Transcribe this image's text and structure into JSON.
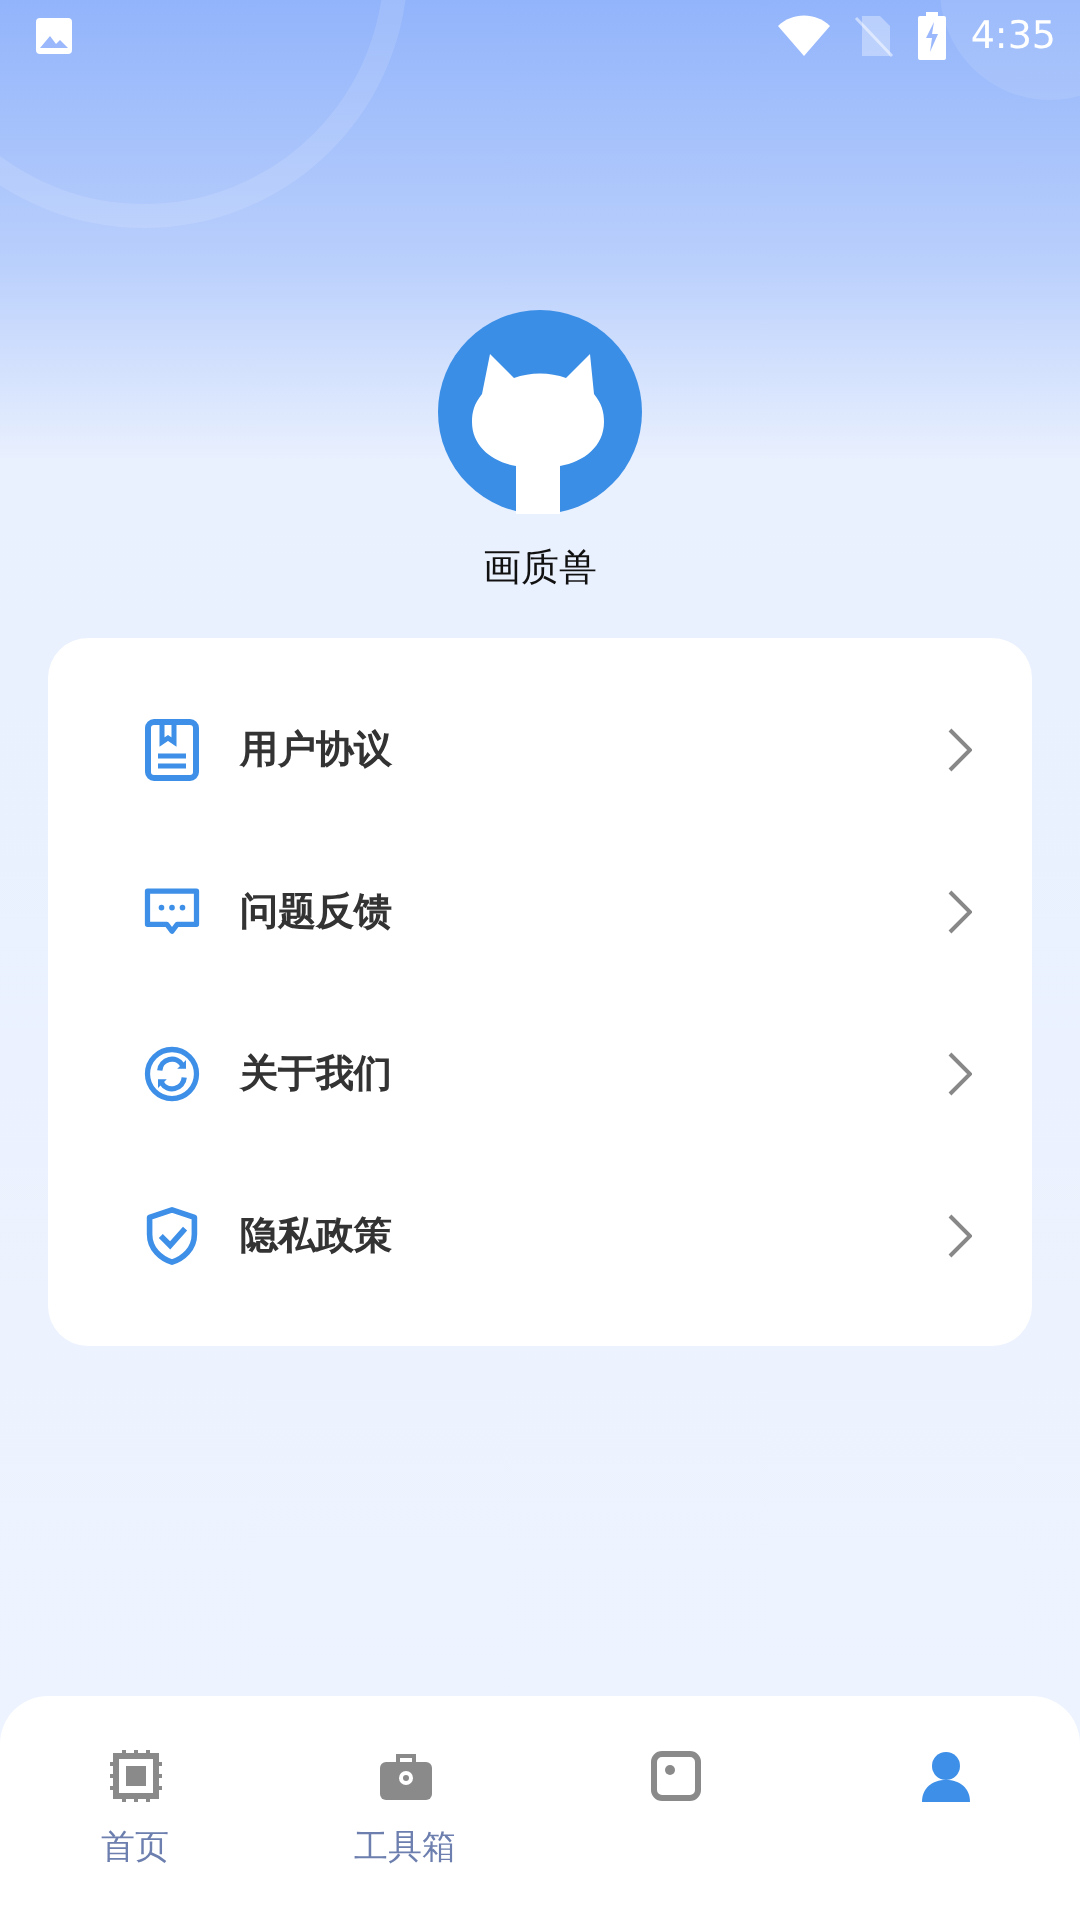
{
  "status_bar": {
    "time": "4:35"
  },
  "profile": {
    "name": "画质兽"
  },
  "menu": [
    {
      "kind": "agreement",
      "label": "用户协议"
    },
    {
      "kind": "feedback",
      "label": "问题反馈"
    },
    {
      "kind": "about",
      "label": "关于我们"
    },
    {
      "kind": "privacy",
      "label": "隐私政策"
    }
  ],
  "bottom_nav": [
    {
      "kind": "chip",
      "label": "首页",
      "selected": false
    },
    {
      "kind": "toolbox",
      "label": "工具箱",
      "selected": false
    },
    {
      "kind": "frame",
      "selected": false
    },
    {
      "kind": "person",
      "selected": true
    }
  ]
}
